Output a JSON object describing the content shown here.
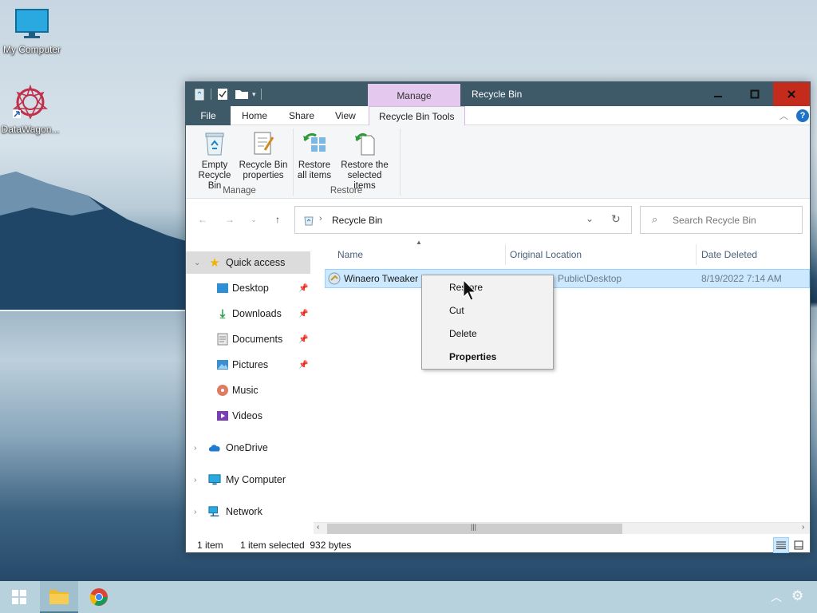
{
  "desktop": {
    "icons": [
      {
        "label": "My Computer"
      },
      {
        "label": "DataWagon..."
      }
    ]
  },
  "window": {
    "title": "Recycle Bin",
    "contextual_group": "Manage",
    "tabs": {
      "file": "File",
      "home": "Home",
      "share": "Share",
      "view": "View",
      "tools": "Recycle Bin Tools"
    },
    "ribbon": {
      "empty_line1": "Empty",
      "empty_line2": "Recycle Bin",
      "props_line1": "Recycle Bin",
      "props_line2": "properties",
      "restore_all_line1": "Restore",
      "restore_all_line2": "all items",
      "restore_sel_line1": "Restore the",
      "restore_sel_line2": "selected items",
      "group_manage": "Manage",
      "group_restore": "Restore"
    },
    "address": {
      "path": "Recycle Bin"
    },
    "search": {
      "placeholder": "Search Recycle Bin"
    },
    "nav": {
      "quick_access": "Quick access",
      "desktop": "Desktop",
      "downloads": "Downloads",
      "documents": "Documents",
      "pictures": "Pictures",
      "music": "Music",
      "videos": "Videos",
      "onedrive": "OneDrive",
      "my_computer": "My Computer",
      "network": "Network"
    },
    "columns": {
      "name": "Name",
      "original_location": "Original Location",
      "date_deleted": "Date Deleted"
    },
    "files": [
      {
        "name": "Winaero Tweaker",
        "location_visible": "Public\\Desktop",
        "date_deleted": "8/19/2022 7:14 AM"
      }
    ],
    "status": {
      "count": "1 item",
      "selection": "1 item selected  932 bytes"
    }
  },
  "context_menu": {
    "restore": "Restore",
    "cut": "Cut",
    "delete": "Delete",
    "properties": "Properties"
  },
  "colors": {
    "titlebar": "#3e5968",
    "manage_accent": "#e4c8ee",
    "selection": "#cce8ff",
    "close": "#c42b1c"
  }
}
